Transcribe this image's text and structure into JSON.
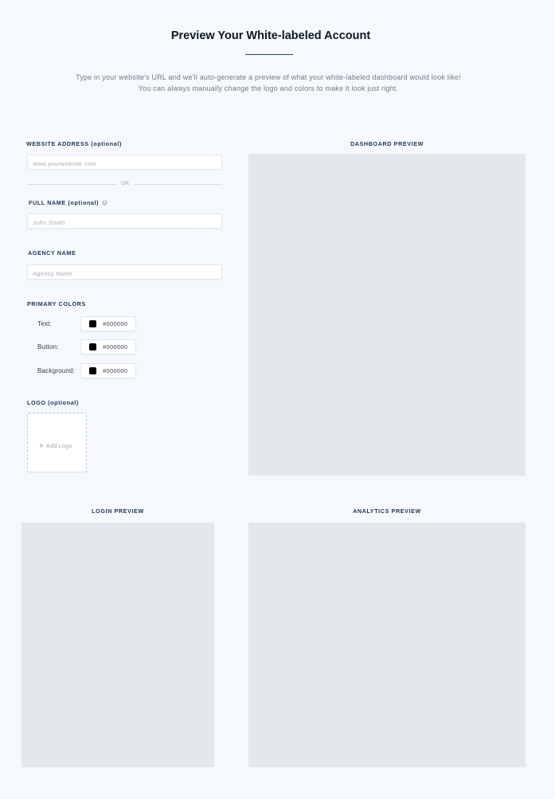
{
  "header": {
    "title": "Preview Your White-labeled Account",
    "intro_line1": "Type in your website's URL and we'll auto-generate a preview of what your white-labeled dashboard would look like!",
    "intro_line2": "You can always manually change the logo and colors to make it look just right."
  },
  "form": {
    "website": {
      "label": "WEBSITE ADDRESS (optional)",
      "value": "",
      "placeholder": "www.yourwebsite.com"
    },
    "or_text": "OR",
    "full_name": {
      "label": "FULL NAME (optional)",
      "value": "",
      "placeholder": "John Smith",
      "info_icon": "info-icon"
    },
    "agency": {
      "label": "AGENCY NAME",
      "value": "",
      "placeholder": "Agency Name"
    },
    "colors": {
      "label": "PRIMARY COLORS",
      "items": [
        {
          "label": "Text:",
          "hex": "#000000",
          "swatch": "#000000"
        },
        {
          "label": "Button:",
          "hex": "#000000",
          "swatch": "#000000"
        },
        {
          "label": "Background:",
          "hex": "#000000",
          "swatch": "#000000"
        }
      ]
    },
    "logo": {
      "label": "LOGO (optional)",
      "add_label": "Add Logo",
      "icon": "plus-icon"
    }
  },
  "previews": {
    "dashboard": "DASHBOARD PREVIEW",
    "login": "LOGIN PREVIEW",
    "analytics": "ANALYTICS PREVIEW"
  },
  "colors": {
    "background": "#f5f9fd",
    "panel": "#e3e8ec",
    "heading": "#0d1726",
    "label": "#1f3357"
  }
}
